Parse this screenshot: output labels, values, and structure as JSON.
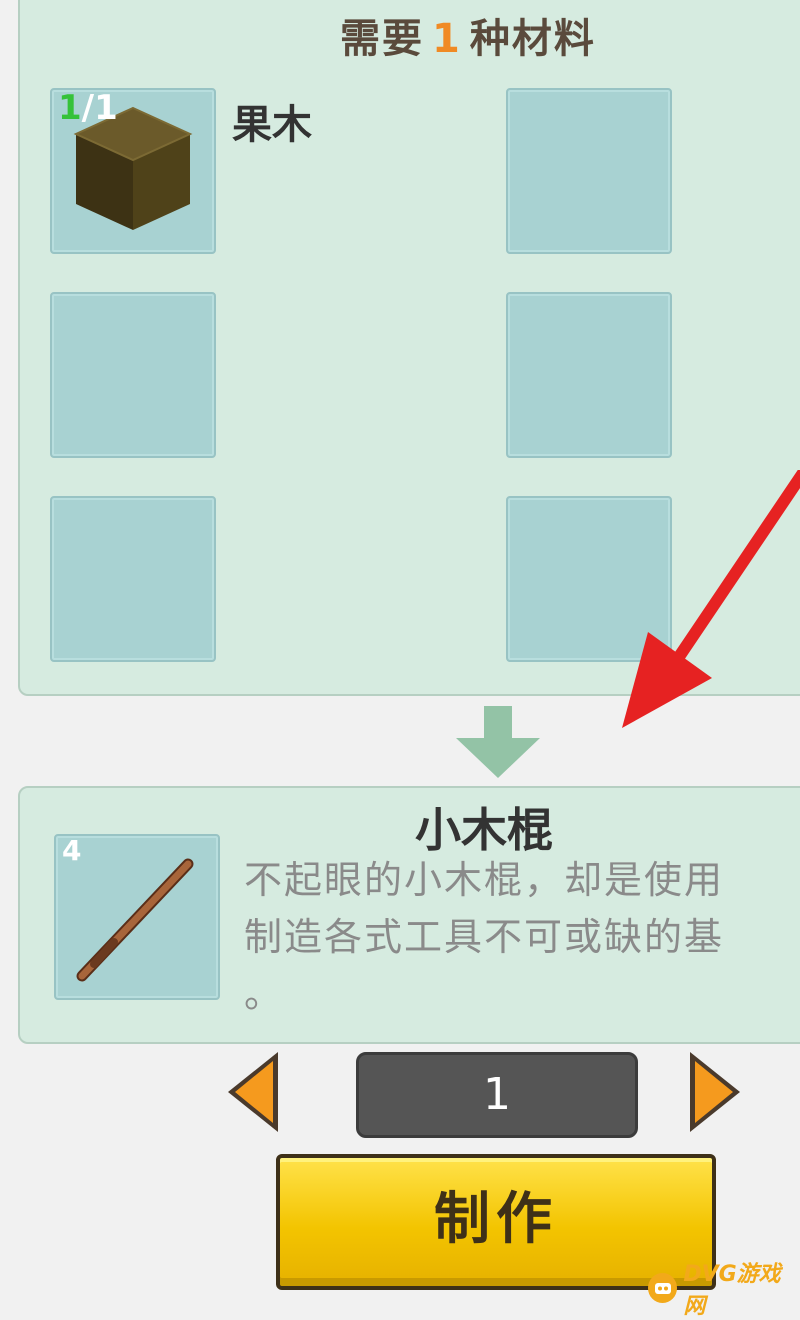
{
  "materials": {
    "title_prefix": "需要",
    "title_count": "1",
    "title_suffix": "种材料",
    "slots": [
      {
        "name": "果木",
        "have": "1",
        "need": "/1"
      }
    ]
  },
  "result": {
    "title": "小木棍",
    "count": "4",
    "description": "不起眼的小木棍，却是使用\n制造各式工具不可或缺的基\n。"
  },
  "quantity": "1",
  "craft_button": "制作",
  "watermark": "DVG游戏网",
  "colors": {
    "panel": "#d6ebe0",
    "slot": "#a8d2d2",
    "accent_orange": "#f08a24",
    "button_yellow": "#f3c400",
    "annotation_red": "#e62222"
  },
  "icons": {
    "material_0": "wood-block-icon",
    "result": "wooden-stick-icon",
    "flow": "down-arrow-icon",
    "prev": "left-triangle-icon",
    "next": "right-triangle-icon"
  }
}
